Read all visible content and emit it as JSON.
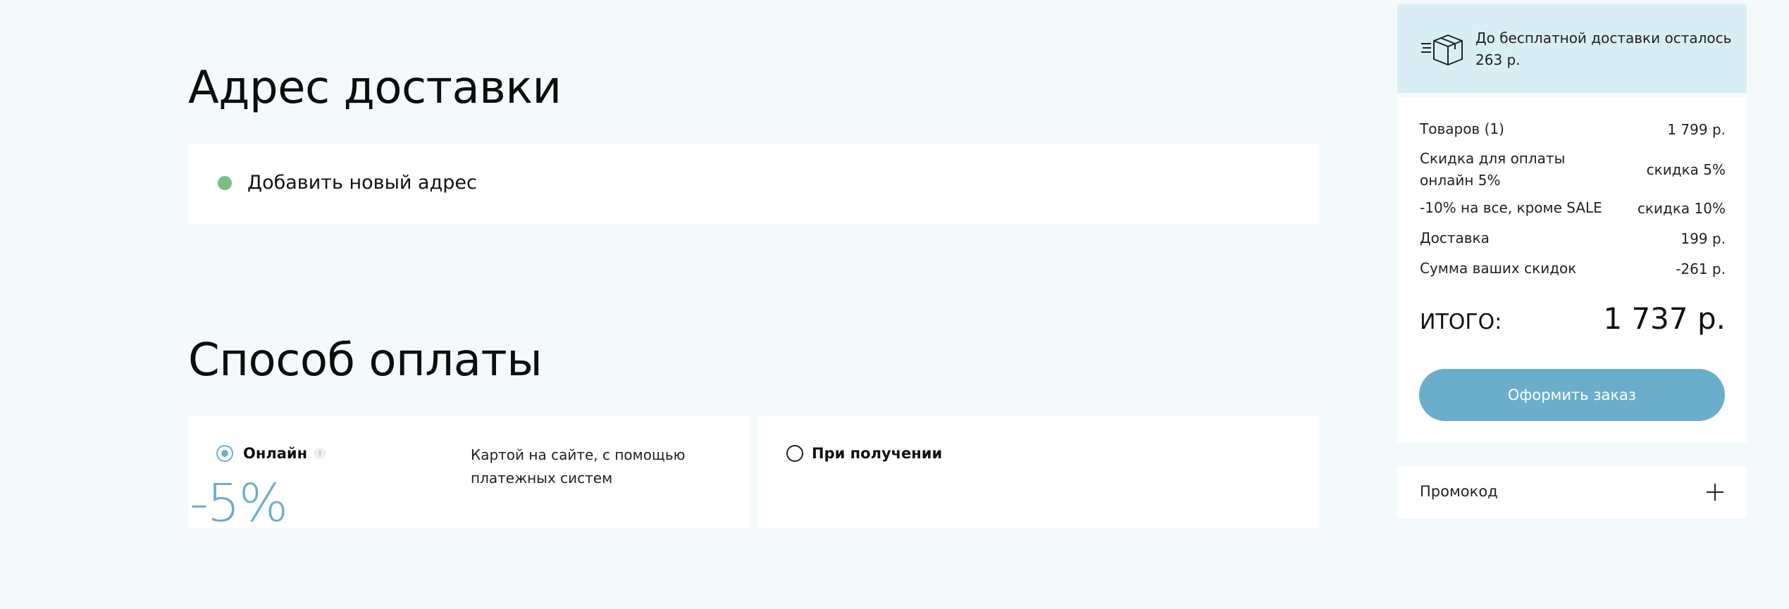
{
  "address": {
    "title": "Адрес доставки",
    "add_label": "Добавить новый адрес"
  },
  "payment": {
    "title": "Способ оплаты",
    "online_label": "Онлайн",
    "online_info": "!",
    "online_desc": "Картой на сайте, с помощью платежных систем",
    "online_discount": "-5%",
    "receipt_label": "При получении"
  },
  "sidebar": {
    "banner_text": "До бесплатной доставки осталось 263 р.",
    "summary": [
      {
        "label": "Товаров (1)",
        "value": "1 799 р."
      },
      {
        "label": "Скидка для оплаты онлайн 5%",
        "value": "скидка 5%"
      },
      {
        "label": "-10% на все, кроме SALE",
        "value": "скидка 10%"
      },
      {
        "label": "Доставка",
        "value": "199 р."
      },
      {
        "label": "Сумма ваших скидок",
        "value": "-261 р."
      }
    ],
    "total_label": "ИТОГО:",
    "total_value": "1 737 р.",
    "checkout_label": "Оформить заказ",
    "promo_label": "Промокод"
  },
  "colors": {
    "accent": "#6aaecb",
    "green_dot": "#7dbb87",
    "banner_bg": "#d9edf5",
    "page_bg": "#f4f9fb"
  }
}
